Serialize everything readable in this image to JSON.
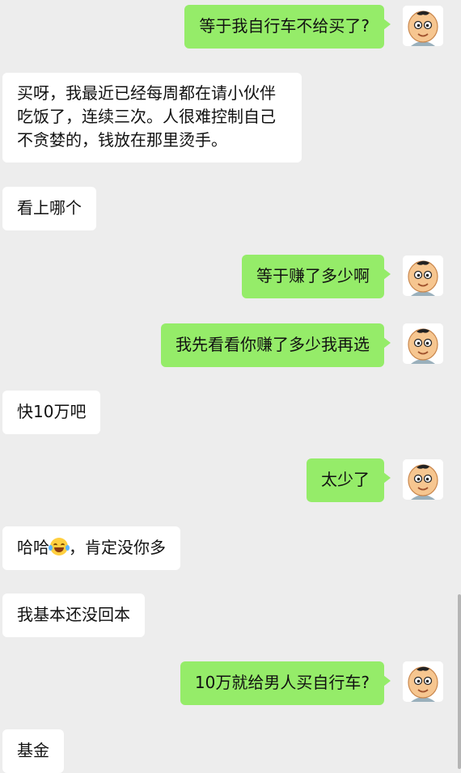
{
  "messages": [
    {
      "side": "out",
      "text": "等于我自行车不给买了?"
    },
    {
      "side": "in",
      "text": "买呀，我最近已经每周都在请小伙伴吃饭了，连续三次。人很难控制自己不贪婪的，钱放在那里烫手。"
    },
    {
      "side": "in",
      "text": "看上哪个"
    },
    {
      "side": "out",
      "text": "等于赚了多少啊"
    },
    {
      "side": "out",
      "text": "我先看看你赚了多少我再选"
    },
    {
      "side": "in",
      "text": "快10万吧"
    },
    {
      "side": "out",
      "text": "太少了"
    },
    {
      "side": "in",
      "text_before": "哈哈",
      "emoji": "laughing-tears-emoji",
      "text_after": "，肯定没你多"
    },
    {
      "side": "in",
      "text": "我基本还没回本"
    },
    {
      "side": "out",
      "text": "10万就给男人买自行车?"
    },
    {
      "side": "in",
      "text": "基金"
    }
  ],
  "colors": {
    "background": "#ededed",
    "out_bubble": "#95ec69",
    "in_bubble": "#ffffff"
  },
  "avatar_icon": "cartoon-boy-avatar"
}
